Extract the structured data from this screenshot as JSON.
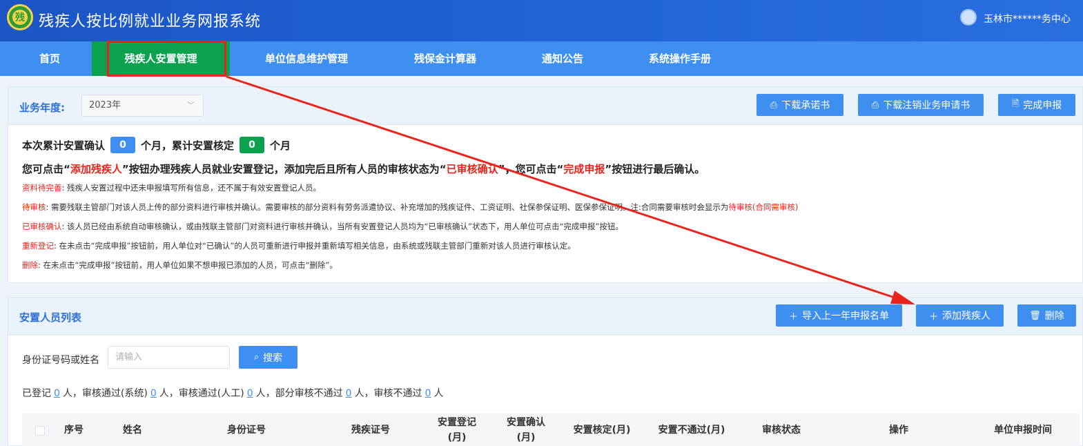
{
  "header": {
    "logo_glyph": "残",
    "title": "残疾人按比例就业业务网报系统",
    "user": "玉林市******务中心"
  },
  "nav": {
    "items": [
      "首页",
      "残疾人安置管理",
      "单位信息维护管理",
      "残保金计算器",
      "通知公告",
      "系统操作手册"
    ],
    "active_index": 1
  },
  "year_panel": {
    "label": "业务年度:",
    "selected_year": "2023年",
    "btn_download_promise": "下载承诺书",
    "btn_download_cancel": "下载注销业务申请书",
    "btn_finish": "完成申报"
  },
  "summary": {
    "part1": "本次累计安置确认",
    "confirm_count": "0",
    "part2": "个月，累计安置核定",
    "verify_count": "0",
    "part3": "个月"
  },
  "hint": {
    "p1": "您可点击“",
    "k1": "添加残疾人",
    "p2": "”按钮办理残疾人员就业安置登记，添加完后且所有人员的审核状态为“",
    "k2": "已审核确认",
    "p3": "”，您可点击“",
    "k3": "完成申报",
    "p4": "”按钮进行最后确认。"
  },
  "notes": [
    {
      "key": "资料待完善",
      "text": ": 残疾人安置过程中还未申报填写所有信息，还不属于有效安置登记人员。"
    },
    {
      "key": "待审核",
      "text": ": 需要残联主管部门对该人员上传的部分资料进行审核并确认。需要审核的部分资料有劳务派遣协议、补充增加的残疾证件、工资证明、社保参保证明、医保参保证明。注:合同需要审核时会显示为",
      "tail": "待审核(合同需审核)"
    },
    {
      "key": "已审核确认",
      "text": ": 该人员已经由系统自动审核确认，或由残联主管部门对资料进行审核并确认，当所有安置登记人员均为“已审核确认”状态下，用人单位可点击“完成申报”按钮。"
    },
    {
      "key": "重新登记",
      "text": ": 在未点击“完成申报”按钮前，用人单位对“已确认”的人员可重新进行申报并重新填写相关信息，由系统或残联主管部门重新对该人员进行审核认定。"
    },
    {
      "key": "删除",
      "text": ": 在未点击“完成申报”按钮前，用人单位如果不想申报已添加的人员，可点击“删除”。"
    }
  ],
  "list_panel": {
    "title": "安置人员列表",
    "btn_import": "导入上一年申报名单",
    "btn_add": "添加残疾人",
    "btn_delete": "删除",
    "search_label": "身份证号码或姓名",
    "search_placeholder": "请输入",
    "btn_search": "搜索"
  },
  "stats": {
    "s1": "已登记",
    "n1": "0",
    "s2": "人，审核通过(系统)",
    "n2": "0",
    "s3": "人，审核通过(人工)",
    "n3": "0",
    "s4": "人，部分审核不通过",
    "n4": "0",
    "s5": "人，审核不通过",
    "n5": "0",
    "s6": "人"
  },
  "table": {
    "columns": [
      "序号",
      "姓名",
      "身份证号",
      "残疾证号",
      "安置登记\n(月)",
      "安置确认\n(月)",
      "安置核定(月)",
      "安置不通过(月)",
      "审核状态",
      "操作",
      "单位申报时间"
    ]
  },
  "colors": {
    "brand_blue": "#3f8ff0",
    "active_green": "#0aa24e",
    "alert_red": "#e8241d"
  }
}
